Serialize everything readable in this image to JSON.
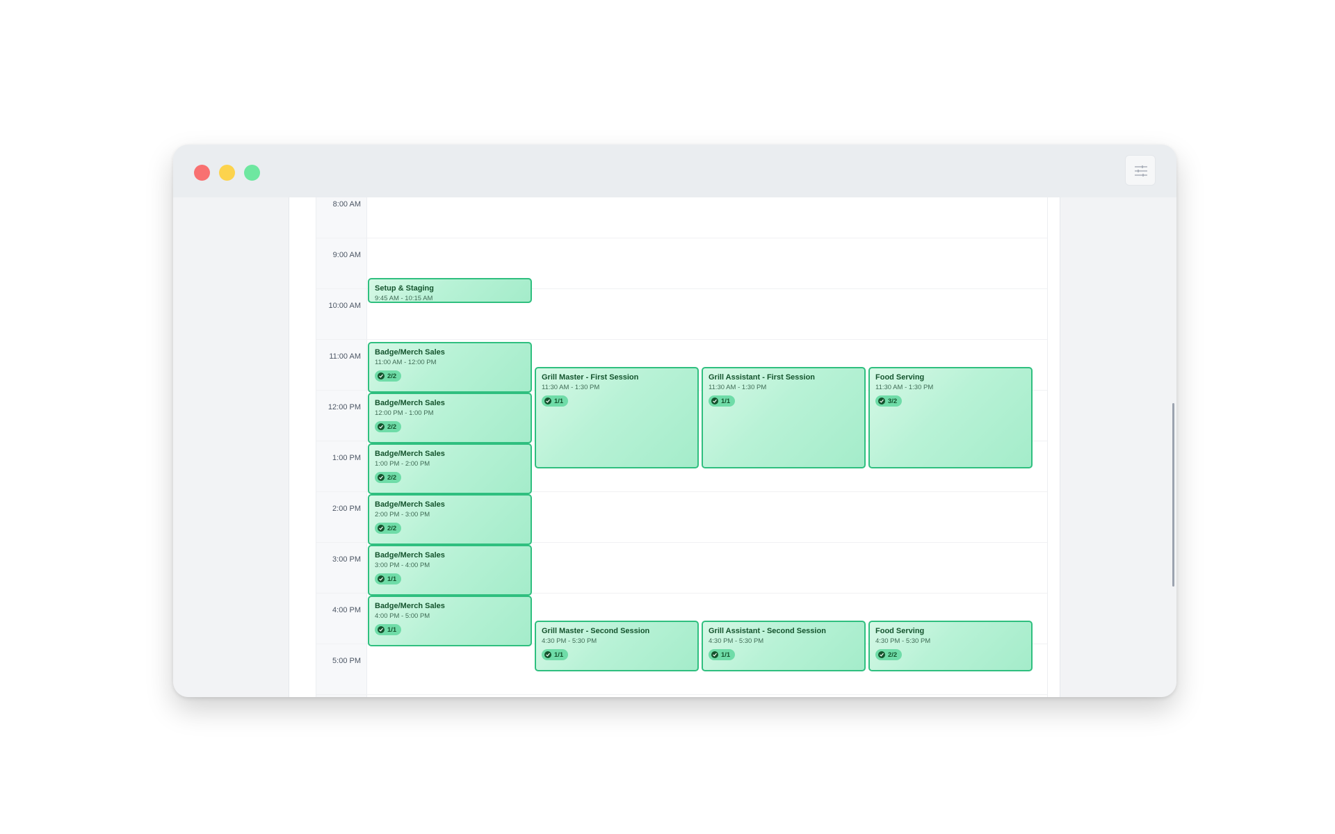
{
  "window": {
    "traffic_lights": [
      "close",
      "minimize",
      "maximize"
    ],
    "settings_icon": "sliders-icon"
  },
  "times": [
    "8:00 AM",
    "9:00 AM",
    "10:00 AM",
    "11:00 AM",
    "12:00 PM",
    "1:00 PM",
    "2:00 PM",
    "3:00 PM",
    "4:00 PM",
    "5:00 PM"
  ],
  "events": [
    {
      "title": "Setup & Staging",
      "time": "9:45 AM - 10:15 AM",
      "count": ""
    },
    {
      "title": "Badge/Merch Sales",
      "time": "11:00 AM - 12:00 PM",
      "count": "2/2"
    },
    {
      "title": "Badge/Merch Sales",
      "time": "12:00 PM - 1:00 PM",
      "count": "2/2"
    },
    {
      "title": "Badge/Merch Sales",
      "time": "1:00 PM - 2:00 PM",
      "count": "2/2"
    },
    {
      "title": "Badge/Merch Sales",
      "time": "2:00 PM - 3:00 PM",
      "count": "2/2"
    },
    {
      "title": "Badge/Merch Sales",
      "time": "3:00 PM - 4:00 PM",
      "count": "1/1"
    },
    {
      "title": "Badge/Merch Sales",
      "time": "4:00 PM - 5:00 PM",
      "count": "1/1"
    },
    {
      "title": "Grill Master - First Session",
      "time": "11:30 AM - 1:30 PM",
      "count": "1/1"
    },
    {
      "title": "Grill Assistant - First Session",
      "time": "11:30 AM - 1:30 PM",
      "count": "1/1"
    },
    {
      "title": "Food Serving",
      "time": "11:30 AM - 1:30 PM",
      "count": "3/2"
    },
    {
      "title": "Grill Master - Second Session",
      "time": "4:30 PM - 5:30 PM",
      "count": "1/1"
    },
    {
      "title": "Grill Assistant - Second Session",
      "time": "4:30 PM - 5:30 PM",
      "count": "1/1"
    },
    {
      "title": "Food Serving",
      "time": "4:30 PM - 5:30 PM",
      "count": "2/2"
    }
  ],
  "colors": {
    "event_border": "#2fbf7f",
    "event_fill": "#b8f2d6",
    "badge": "#6fdca8",
    "close": "#f87171",
    "minimize": "#fcd34d",
    "maximize": "#6ee7a0"
  }
}
